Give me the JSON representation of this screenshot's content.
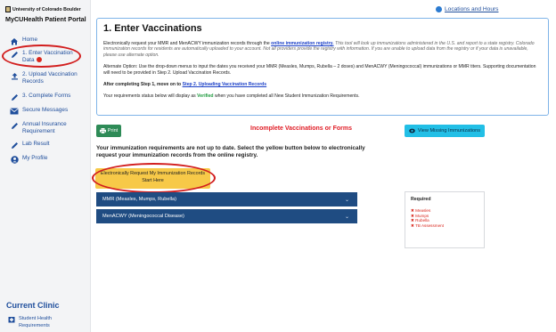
{
  "logo": {
    "university": "University of Colorado Boulder",
    "portal": "MyCUHealth Patient Portal"
  },
  "sidebar": {
    "items": [
      {
        "label": "Home",
        "icon": "home-icon"
      },
      {
        "label": "1. Enter Vaccination Data",
        "icon": "pencil-icon"
      },
      {
        "label": "2. Upload Vaccination Records",
        "icon": "upload-icon"
      },
      {
        "label": "3. Complete Forms",
        "icon": "pencil-icon"
      },
      {
        "label": "Secure Messages",
        "icon": "envelope-icon"
      },
      {
        "label": "Annual Insurance Requirement",
        "icon": "pencil-icon"
      },
      {
        "label": "Lab Result",
        "icon": "pencil-icon"
      },
      {
        "label": "My Profile",
        "icon": "user-icon"
      }
    ],
    "current_clinic": "Current Clinic",
    "clinic_item": "Student Health Requirements"
  },
  "top_link": "Locations and Hours",
  "panel": {
    "title": "1. Enter Vaccinations",
    "p1_before": "Electronically request your MMR and MenACWY immunization records through the ",
    "p1_link": "online immunization registry.",
    "p1_italic": "This tool will look up immunizations administered in the U.S. and report to a state registry. Colorado immunization records for residents are automatically uploaded to your account. Not all providers provide the registry with information. If you are unable to upload data from the registry or if your data is unavailable, please use alternate option.",
    "p2": "Alternate Option: Use the drop-down menus to input the dates you received your MMR (Measles, Mumps, Rubella – 2 doses) and MenACWY (Meningococcal) immunizations or MMR titers. Supporting documentation will need to be provided in Step 2. Upload Vaccination Records.",
    "p3_before": "After completing Step 1, move on to ",
    "p3_link": "Step 2. Uploading Vaccination Records",
    "p4_before": "Your requirements status below will display as ",
    "p4_verified": "Verified",
    "p4_after": " when you have completed all New Student Immunization Requirements."
  },
  "actions": {
    "print": "Print",
    "status": "Incomplete Vaccinations or Forms",
    "view_missing": "View Missing Immunizations"
  },
  "notice": "Your immunization requirements are not up to date. Select the yellow button below to electronically request your immunization records from the online registry.",
  "request_button": {
    "line1": "Electronically Request My Immunization Records",
    "line2": "Start Here"
  },
  "accordions": [
    "MMR (Measles, Mumps, Rubella)",
    "MenACWY (Meningococcal Disease)"
  ],
  "required": {
    "title": "Required",
    "items": [
      "Measles",
      "Mumps",
      "Rubella",
      "TB Assessment"
    ],
    "marker": "✖"
  },
  "colors": {
    "nav_text": "#1f4e9c",
    "accordion": "#1f4c82",
    "request_button": "#f7c948",
    "view_button": "#22bfe6",
    "print_button": "#2e8b57",
    "alert": "#e01b24",
    "verified": "#1e9a3d",
    "annotation_ring": "#d21e1e"
  }
}
